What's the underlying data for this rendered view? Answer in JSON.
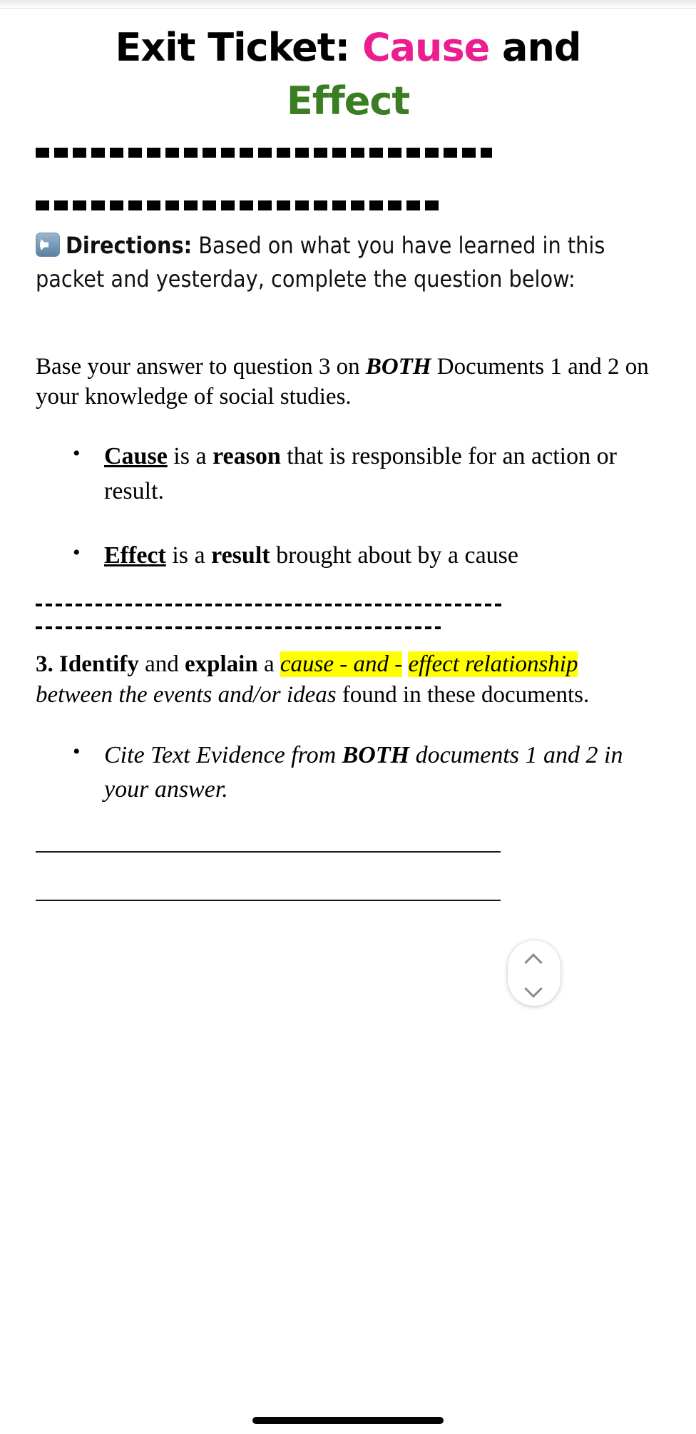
{
  "document": {
    "title": {
      "part1": "Exit Ticket: ",
      "highlight_cause": "Cause",
      "part2": " and ",
      "highlight_effect": "Effect",
      "cause_color": "#EC1E8F",
      "effect_color": "#3A7D22"
    },
    "directions": {
      "icon": "right-arrow-emoji",
      "label": "Directions:",
      "text": " Based on what you have learned in this packet and yesterday, complete the question below:"
    },
    "base_paragraph": {
      "lead": "Base your answer to question 3 on ",
      "both": "BOTH",
      "rest": " Documents 1 and 2 on your knowledge of social studies."
    },
    "definitions": [
      {
        "term": "Cause",
        "mid_before": " is a ",
        "strong": "reason",
        "mid_after": " that is responsible for an action or result."
      },
      {
        "term": "Effect",
        "mid_before": " is a ",
        "strong": "result",
        "mid_after": " brought about by a cause"
      }
    ],
    "question": {
      "number": "3.",
      "verb1": "Identify",
      "conj": " and ",
      "verb2": "explain",
      "article": " a ",
      "highlight_1": "cause - and -",
      "highlight_2": "effect relationship",
      "tail_italic": " between the events and/or ideas",
      "tail_plain": " found in these documents.",
      "highlight_color": "#FFFF00"
    },
    "cite_bullet": {
      "lead": "Cite Text Evidence from ",
      "both": "BOTH",
      "rest": " documents 1 and 2 in your answer."
    },
    "scroll_control": {
      "up_icon": "chevron-up-icon",
      "down_icon": "chevron-down-icon"
    }
  }
}
